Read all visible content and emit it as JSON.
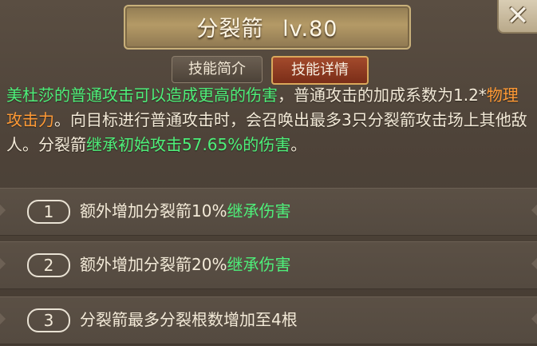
{
  "header": {
    "skill_name": "分裂箭",
    "level": "lv.80",
    "close_label": "✕"
  },
  "tabs": [
    {
      "label": "技能简介",
      "active": false
    },
    {
      "label": "技能详情",
      "active": true
    }
  ],
  "description": {
    "p1": "美杜莎的普通攻击可以造成更高的伤害",
    "p2": "，普通攻击的加成系数为1.2*",
    "p3": "物理攻击力",
    "p4": "。向目标进行普通攻击时，会召唤出最多3只分裂箭攻击场上其他敌人。分裂箭",
    "p5": "继承初始攻击57.65%的伤害",
    "p6": "。"
  },
  "upgrades": [
    {
      "number": "1",
      "text": "额外增加分裂箭10%",
      "highlight": "继承伤害"
    },
    {
      "number": "2",
      "text": "额外增加分裂箭20%",
      "highlight": "继承伤害"
    },
    {
      "number": "3",
      "text": "分裂箭最多分裂根数增加至4根",
      "highlight": ""
    }
  ],
  "colors": {
    "highlight_green": "#4ef07a",
    "highlight_orange": "#ff9a35",
    "active_tab": "#a34a2c"
  }
}
